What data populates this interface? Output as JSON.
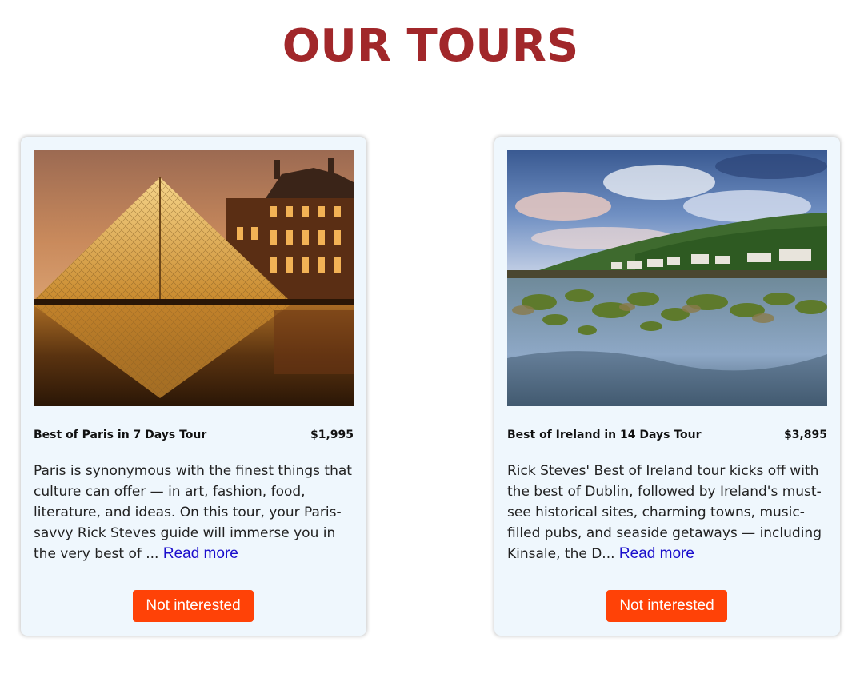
{
  "page": {
    "title": "OUR TOURS"
  },
  "tours": [
    {
      "name": "Best of Paris in 7 Days Tour",
      "price": "$1,995",
      "description": "Paris is synonymous with the finest things that culture can offer — in art, fashion, food, literature, and ideas. On this tour, your Paris-savvy Rick Steves guide will immerse you in the very best of ...",
      "read_more_label": "Read more",
      "button_label": "Not interested",
      "image_subject": "Louvre pyramid at night"
    },
    {
      "name": "Best of Ireland in 14 Days Tour",
      "price": "$3,895",
      "description": "Rick Steves' Best of Ireland tour kicks off with the best of Dublin, followed by Ireland's must-see historical sites, charming towns, music-filled pubs, and seaside getaways — including Kinsale, the D...",
      "read_more_label": "Read more",
      "button_label": "Not interested",
      "image_subject": "Irish coastal town with rocky shore"
    }
  ],
  "colors": {
    "title": "#a1272a",
    "card_background": "#eff7fd",
    "button": "#ff4207",
    "link": "#1a0dcc"
  }
}
